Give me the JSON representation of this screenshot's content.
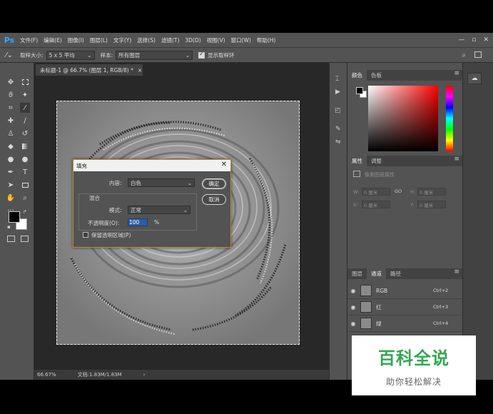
{
  "app": {
    "logo": "Ps",
    "menu": [
      "文件(F)",
      "编辑(E)",
      "图像(I)",
      "图层(L)",
      "文字(Y)",
      "选择(S)",
      "滤镜(T)",
      "3D(D)",
      "视图(V)",
      "窗口(W)",
      "帮助(H)"
    ],
    "window_controls": [
      "—",
      "▫",
      "✕"
    ]
  },
  "options_bar": {
    "sample_size_label": "取样大小:",
    "sample_size_value": "5 x 5 平均",
    "sample_label": "样本:",
    "sample_value": "所有图层",
    "show_ring_label": "显示取样环"
  },
  "document": {
    "tab_title": "未标题-1 @ 66.7% (图层 1, RGB/8) *",
    "tab_close": "×",
    "zoom": "66.67%",
    "doc_info": "文档:1.83M/1.83M",
    "arrow": "›"
  },
  "fill_dialog": {
    "title": "填充",
    "close": "✕",
    "contents_label": "内容:",
    "contents_value": "白色",
    "blending_label": "混合",
    "mode_label": "模式:",
    "mode_value": "正常",
    "opacity_label": "不透明度(O):",
    "opacity_value": "100",
    "opacity_unit": "%",
    "preserve_label": "保留透明区域(P)",
    "ok_label": "确定",
    "cancel_label": "取消"
  },
  "color_panel": {
    "tabs": [
      "颜色",
      "色板"
    ],
    "menu": "≡"
  },
  "properties_panel": {
    "tabs": [
      "属性",
      "调整"
    ],
    "subtitle": "像素图层属性",
    "w_label": "W:",
    "w_value": "0 厘米",
    "h_label": "H:",
    "h_value": "0 厘米",
    "x_label": "X:",
    "x_value": "0 厘米",
    "y_label": "Y:",
    "y_value": "0 厘米",
    "link": "GO"
  },
  "channels_panel": {
    "tabs": [
      "图层",
      "通道",
      "路径"
    ],
    "channels": [
      {
        "name": "RGB",
        "shortcut": "Ctrl+2"
      },
      {
        "name": "红",
        "shortcut": "Ctrl+3"
      },
      {
        "name": "绿",
        "shortcut": "Ctrl+4"
      }
    ]
  },
  "watermark": {
    "title": "百科全说",
    "subtitle": "助你轻松解决"
  },
  "colors": {
    "ui_bg": "#535353",
    "dark_bg": "#282828",
    "accent_blue": "#2b5ea8",
    "watermark_green": "#32a852"
  }
}
